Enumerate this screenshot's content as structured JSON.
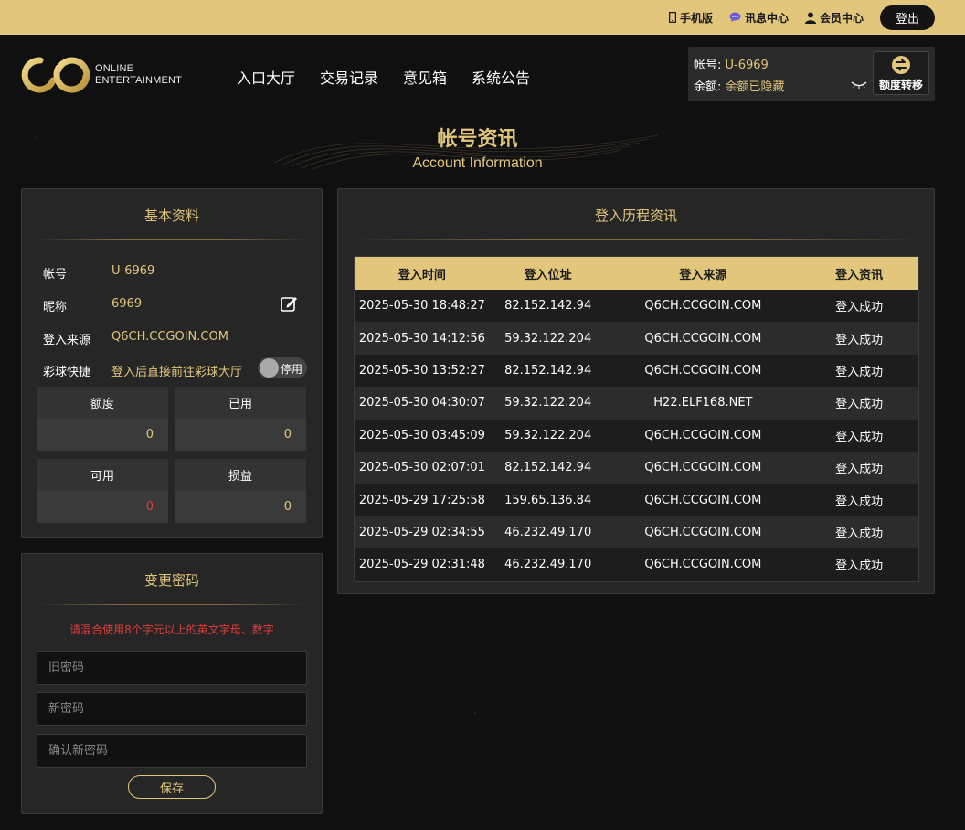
{
  "topbar": {
    "mobile_label": "手机版",
    "messages_label": "讯息中心",
    "member_label": "会员中心",
    "logout_label": "登出"
  },
  "logo": {
    "line1": "ONLINE",
    "line2": "ENTERTAINMENT"
  },
  "nav": [
    "入口大厅",
    "交易记录",
    "意见箱",
    "系统公告"
  ],
  "account_box": {
    "account_label": "帐号:",
    "account_value": "U-6969",
    "balance_label": "余额:",
    "balance_value": "余额已隐藏",
    "transfer_label": "额度转移"
  },
  "page_title": {
    "cn": "帐号资讯",
    "en": "Account Information"
  },
  "basic": {
    "title": "基本资料",
    "rows": [
      {
        "label": "帐号",
        "value": "U-6969"
      },
      {
        "label": "昵称",
        "value": "6969"
      },
      {
        "label": "登入来源",
        "value": "Q6CH.CCGOIN.COM"
      },
      {
        "label": "彩球快捷",
        "value": "登入后直接前往彩球大厅"
      }
    ],
    "toggle_label": "停用",
    "stats": [
      {
        "label": "额度",
        "value": "0"
      },
      {
        "label": "已用",
        "value": "0"
      },
      {
        "label": "可用",
        "value": "0"
      },
      {
        "label": "损益",
        "value": "0"
      }
    ]
  },
  "password": {
    "title": "变更密码",
    "hint": "请混合使用8个字元以上的英文字母、数字",
    "old_placeholder": "旧密码",
    "new_placeholder": "新密码",
    "confirm_placeholder": "确认新密码",
    "save_label": "保存"
  },
  "login_history": {
    "title": "登入历程资讯",
    "columns": [
      "登入时间",
      "登入位址",
      "登入来源",
      "登入资讯"
    ],
    "rows": [
      [
        "2025-05-30 18:48:27",
        "82.152.142.94",
        "Q6CH.CCGOIN.COM",
        "登入成功"
      ],
      [
        "2025-05-30 14:12:56",
        "59.32.122.204",
        "Q6CH.CCGOIN.COM",
        "登入成功"
      ],
      [
        "2025-05-30 13:52:27",
        "82.152.142.94",
        "Q6CH.CCGOIN.COM",
        "登入成功"
      ],
      [
        "2025-05-30 04:30:07",
        "59.32.122.204",
        "H22.ELF168.NET",
        "登入成功"
      ],
      [
        "2025-05-30 03:45:09",
        "59.32.122.204",
        "Q6CH.CCGOIN.COM",
        "登入成功"
      ],
      [
        "2025-05-30 02:07:01",
        "82.152.142.94",
        "Q6CH.CCGOIN.COM",
        "登入成功"
      ],
      [
        "2025-05-29 17:25:58",
        "159.65.136.84",
        "Q6CH.CCGOIN.COM",
        "登入成功"
      ],
      [
        "2025-05-29 02:34:55",
        "46.232.49.170",
        "Q6CH.CCGOIN.COM",
        "登入成功"
      ],
      [
        "2025-05-29 02:31:48",
        "46.232.49.170",
        "Q6CH.CCGOIN.COM",
        "登入成功"
      ]
    ]
  },
  "colors": {
    "accent": "#e2c67c",
    "error": "#e03c3c",
    "background": "#101010"
  }
}
